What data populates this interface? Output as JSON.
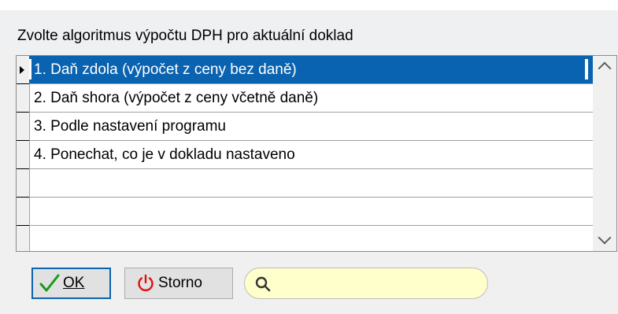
{
  "dialog": {
    "title": "Zvolte algoritmus výpočtu DPH pro aktuální doklad"
  },
  "list": {
    "items": [
      {
        "label": "1. Daň zdola (výpočet z ceny bez daně)",
        "selected": true
      },
      {
        "label": "2. Daň shora (výpočet z ceny včetně daně)",
        "selected": false
      },
      {
        "label": "3. Podle nastavení programu",
        "selected": false
      },
      {
        "label": "4. Ponechat, co je v dokladu nastaveno",
        "selected": false
      },
      {
        "label": "",
        "selected": false
      },
      {
        "label": "",
        "selected": false
      },
      {
        "label": "",
        "selected": false
      }
    ]
  },
  "buttons": {
    "ok_label": "OK",
    "storno_label": "Storno"
  },
  "search": {
    "value": "",
    "placeholder": ""
  },
  "colors": {
    "selection": "#0a63b0",
    "search_bg": "#ffffcc",
    "ok_check": "#1a9a1a",
    "storno_power": "#e01010"
  },
  "icons": {
    "ok": "check-icon",
    "storno": "power-icon",
    "search": "search-icon",
    "scroll_up": "chevron-up-icon",
    "scroll_down": "chevron-down-icon",
    "row_pointer": "row-pointer-icon"
  }
}
